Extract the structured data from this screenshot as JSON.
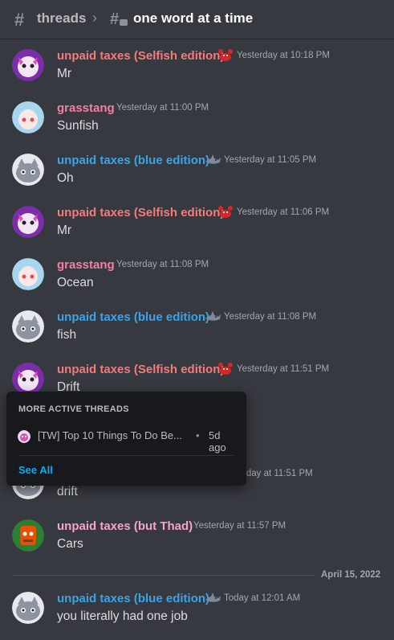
{
  "header": {
    "parent_channel": "threads",
    "thread_name": "one word at a time"
  },
  "messages": [
    {
      "author": "unpaid taxes (Selfish edition)",
      "author_color": "#f47b7b",
      "emoji": "crab",
      "time": "Yesterday at 10:18 PM",
      "text": "Mr",
      "avatar": "pink-cat"
    },
    {
      "author": "grasstang",
      "author_color": "#f47fa4",
      "time": "Yesterday at 11:00 PM",
      "text": "Sunfish",
      "avatar": "anime-girl"
    },
    {
      "author": "unpaid taxes (blue edition)",
      "author_color": "#3ba3e6",
      "emoji": "shark",
      "time": "Yesterday at 11:05 PM",
      "text": "Oh",
      "avatar": "grey-cat"
    },
    {
      "author": "unpaid taxes (Selfish edition)",
      "author_color": "#f47b7b",
      "emoji": "crab",
      "time": "Yesterday at 11:06 PM",
      "text": "Mr",
      "avatar": "pink-cat"
    },
    {
      "author": "grasstang",
      "author_color": "#f47fa4",
      "time": "Yesterday at 11:08 PM",
      "text": "Ocean",
      "avatar": "anime-girl"
    },
    {
      "author": "unpaid taxes (blue edition)",
      "author_color": "#3ba3e6",
      "emoji": "shark",
      "time": "Yesterday at 11:08 PM",
      "text": "fish",
      "avatar": "grey-cat"
    },
    {
      "author": "unpaid taxes (Selfish edition)",
      "author_color": "#f47b7b",
      "emoji": "crab",
      "time": "Yesterday at 11:51 PM",
      "text": "Drift",
      "avatar": "pink-cat"
    },
    {
      "author": "",
      "time": "rday at 11:51 PM",
      "text": "drift",
      "avatar": "grey-cat"
    },
    {
      "author": "unpaid taxes (but Thad)",
      "author_color": "#f5a3c7",
      "time": "Yesterday at 11:57 PM",
      "text": "Cars",
      "avatar": "thad"
    },
    {
      "author": "unpaid taxes (blue edition)",
      "author_color": "#3ba3e6",
      "emoji": "shark",
      "time": "Today at 12:01 AM",
      "text": "you literally had one job",
      "avatar": "grey-cat"
    }
  ],
  "date_divider": "April 15, 2022",
  "popup": {
    "heading": "MORE ACTIVE THREADS",
    "thread_title": "[TW] Top 10 Things To Do Be...",
    "separator_dot": "•",
    "thread_age": "5d ago",
    "see_all": "See All"
  }
}
